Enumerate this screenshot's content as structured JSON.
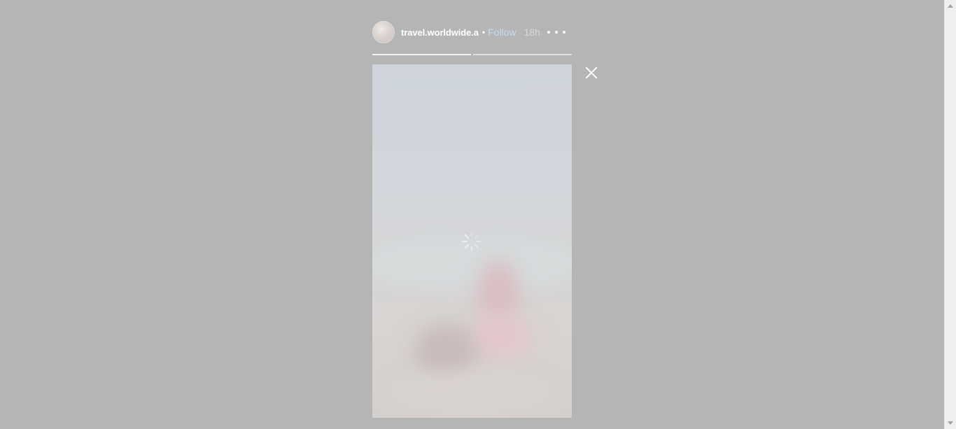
{
  "story": {
    "username": "travel.worldwide.a",
    "separator": "•",
    "follow_label": "Follow",
    "time": "18h",
    "segments": [
      {
        "state": "complete"
      },
      {
        "state": "pending"
      }
    ]
  },
  "colors": {
    "backdrop": "#b5b5b5",
    "follow": "#c3dcf3",
    "text": "#ffffff"
  },
  "icons": {
    "close": "close-icon",
    "more": "more-options-icon",
    "loading": "loading-spinner-icon"
  }
}
